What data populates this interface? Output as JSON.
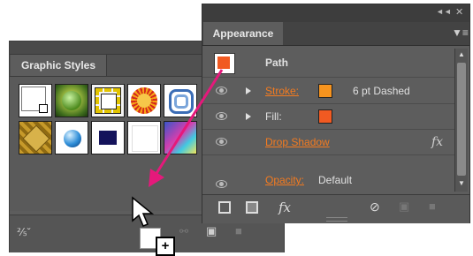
{
  "graphic_styles_panel": {
    "tab_label": "Graphic Styles",
    "swatches": [
      {
        "name": "default-style"
      },
      {
        "name": "bevel-green"
      },
      {
        "name": "dashed-yellow-frame"
      },
      {
        "name": "orange-sun"
      },
      {
        "name": "blue-spiral"
      },
      {
        "name": "gold-texture"
      },
      {
        "name": "blue-sphere"
      },
      {
        "name": "navy-square"
      },
      {
        "name": "white-square"
      },
      {
        "name": "multicolor-gradient"
      }
    ],
    "footer_icons": [
      "libraries-menu-icon",
      "break-link-icon",
      "new-style-icon",
      "delete-icon"
    ]
  },
  "appearance_panel": {
    "tab_label": "Appearance",
    "header": {
      "object_label": "Path",
      "thumbnail_color": "#f15a22"
    },
    "rows": [
      {
        "label": "Stroke:",
        "swatch_color": "#f7941e",
        "value": "6 pt Dashed"
      },
      {
        "label": "Fill:",
        "swatch_color": "#f15a22"
      },
      {
        "label": "Drop Shadow",
        "fx": "fx"
      },
      {
        "label": "Opacity:",
        "value": "Default"
      }
    ],
    "footer_icons": [
      "add-stroke-icon",
      "add-fill-icon",
      "fx-icon",
      "clear-appearance-icon",
      "duplicate-icon",
      "delete-icon"
    ],
    "fx_label": "fx"
  },
  "drag_cursor": {
    "plus": "+"
  },
  "colors": {
    "accent_link": "#f47b20",
    "arrow": "#e5197b"
  }
}
